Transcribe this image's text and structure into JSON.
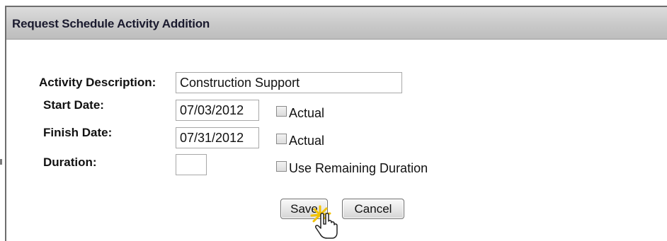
{
  "dialog": {
    "title": "Request Schedule Activity Addition"
  },
  "form": {
    "activity_description": {
      "label": "Activity Description:",
      "value": "Construction Support"
    },
    "start_date": {
      "label": "Start Date:",
      "value": "07/03/2012",
      "actual_label": "Actual",
      "actual_checked": false
    },
    "finish_date": {
      "label": "Finish Date:",
      "value": "07/31/2012",
      "actual_label": "Actual",
      "actual_checked": false
    },
    "duration": {
      "label": "Duration:",
      "value": "",
      "remaining_label": "Use Remaining Duration",
      "remaining_checked": false
    }
  },
  "buttons": {
    "save_label": "Save",
    "cancel_label": "Cancel"
  },
  "cursor": {
    "icon": "hand-pointer-click-icon",
    "highlight_color": "#f2c200"
  }
}
